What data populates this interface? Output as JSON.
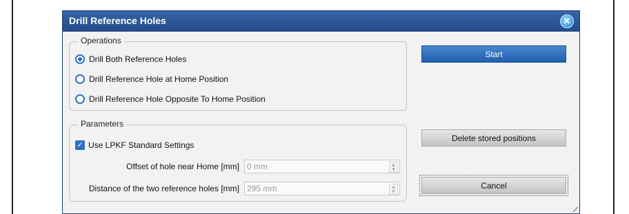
{
  "window": {
    "title": "Drill Reference Holes",
    "close_icon": "close-icon"
  },
  "operations": {
    "legend": "Operations",
    "options": [
      {
        "label": "Drill Both Reference Holes",
        "checked": true
      },
      {
        "label": "Drill Reference Hole at Home Position",
        "checked": false
      },
      {
        "label": "Drill Reference Hole Opposite To Home Position",
        "checked": false
      }
    ]
  },
  "parameters": {
    "legend": "Parameters",
    "use_standard": {
      "label": "Use LPKF Standard Settings",
      "checked": true
    },
    "offset": {
      "label": "Offset of hole near Home [mm]",
      "value": "0 mm"
    },
    "distance": {
      "label": "Distance of the two reference holes [mm]",
      "value": "295 mm"
    }
  },
  "buttons": {
    "start": "Start",
    "delete": "Delete stored positions",
    "cancel": "Cancel"
  },
  "colors": {
    "titlebar": "#234b86",
    "accent": "#2f72c4"
  }
}
